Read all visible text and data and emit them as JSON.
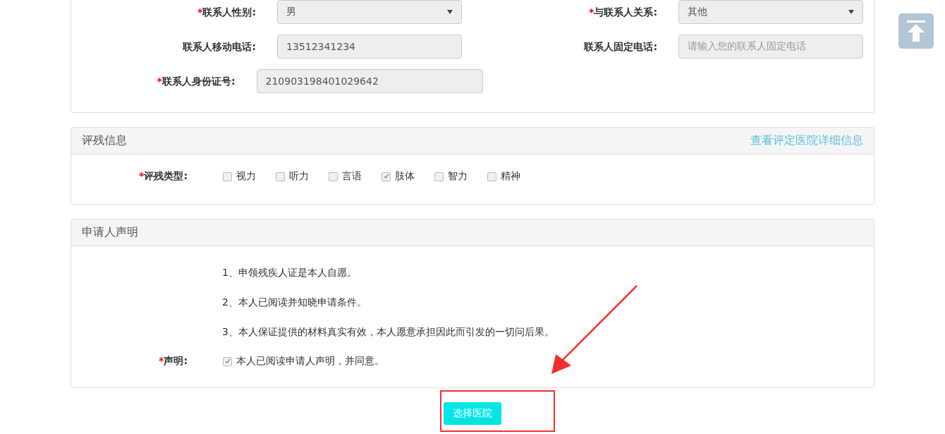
{
  "contact": {
    "rows": [
      [
        {
          "label": "联系人性别:",
          "required_mark": "*",
          "kind": "select",
          "value": "男"
        },
        {
          "label": "与联系人关系:",
          "required_mark": "*",
          "kind": "select",
          "value": "其他"
        }
      ],
      [
        {
          "label": "联系人移动电话:",
          "kind": "input",
          "value": "13512341234"
        },
        {
          "label": "联系人固定电话:",
          "kind": "input",
          "placeholder": "请输入您的联系人固定电话"
        }
      ],
      [
        {
          "label": "联系人身份证号:",
          "required_mark": "*",
          "kind": "input-wide",
          "value": "210903198401029642"
        }
      ]
    ]
  },
  "assessment": {
    "title": "评残信息",
    "link": "查看评定医院详细信息",
    "label": "评残类型:",
    "required_mark": "*",
    "options": [
      {
        "label": "视力",
        "checked": false
      },
      {
        "label": "听力",
        "checked": false
      },
      {
        "label": "言语",
        "checked": false
      },
      {
        "label": "肢体",
        "checked": true
      },
      {
        "label": "智力",
        "checked": false
      },
      {
        "label": "精神",
        "checked": false
      }
    ]
  },
  "declaration": {
    "title": "申请人声明",
    "items": [
      "1、申领残疾人证是本人自愿。",
      "2、本人已阅读并知晓申请条件。",
      "3、本人保证提供的材料真实有效，本人愿意承担因此而引发的一切问后果。"
    ],
    "label": "声明:",
    "required_mark": "*",
    "agree": {
      "label": "本人已阅读申请人声明，并同意。",
      "checked": true
    }
  },
  "submit": "选择医院"
}
